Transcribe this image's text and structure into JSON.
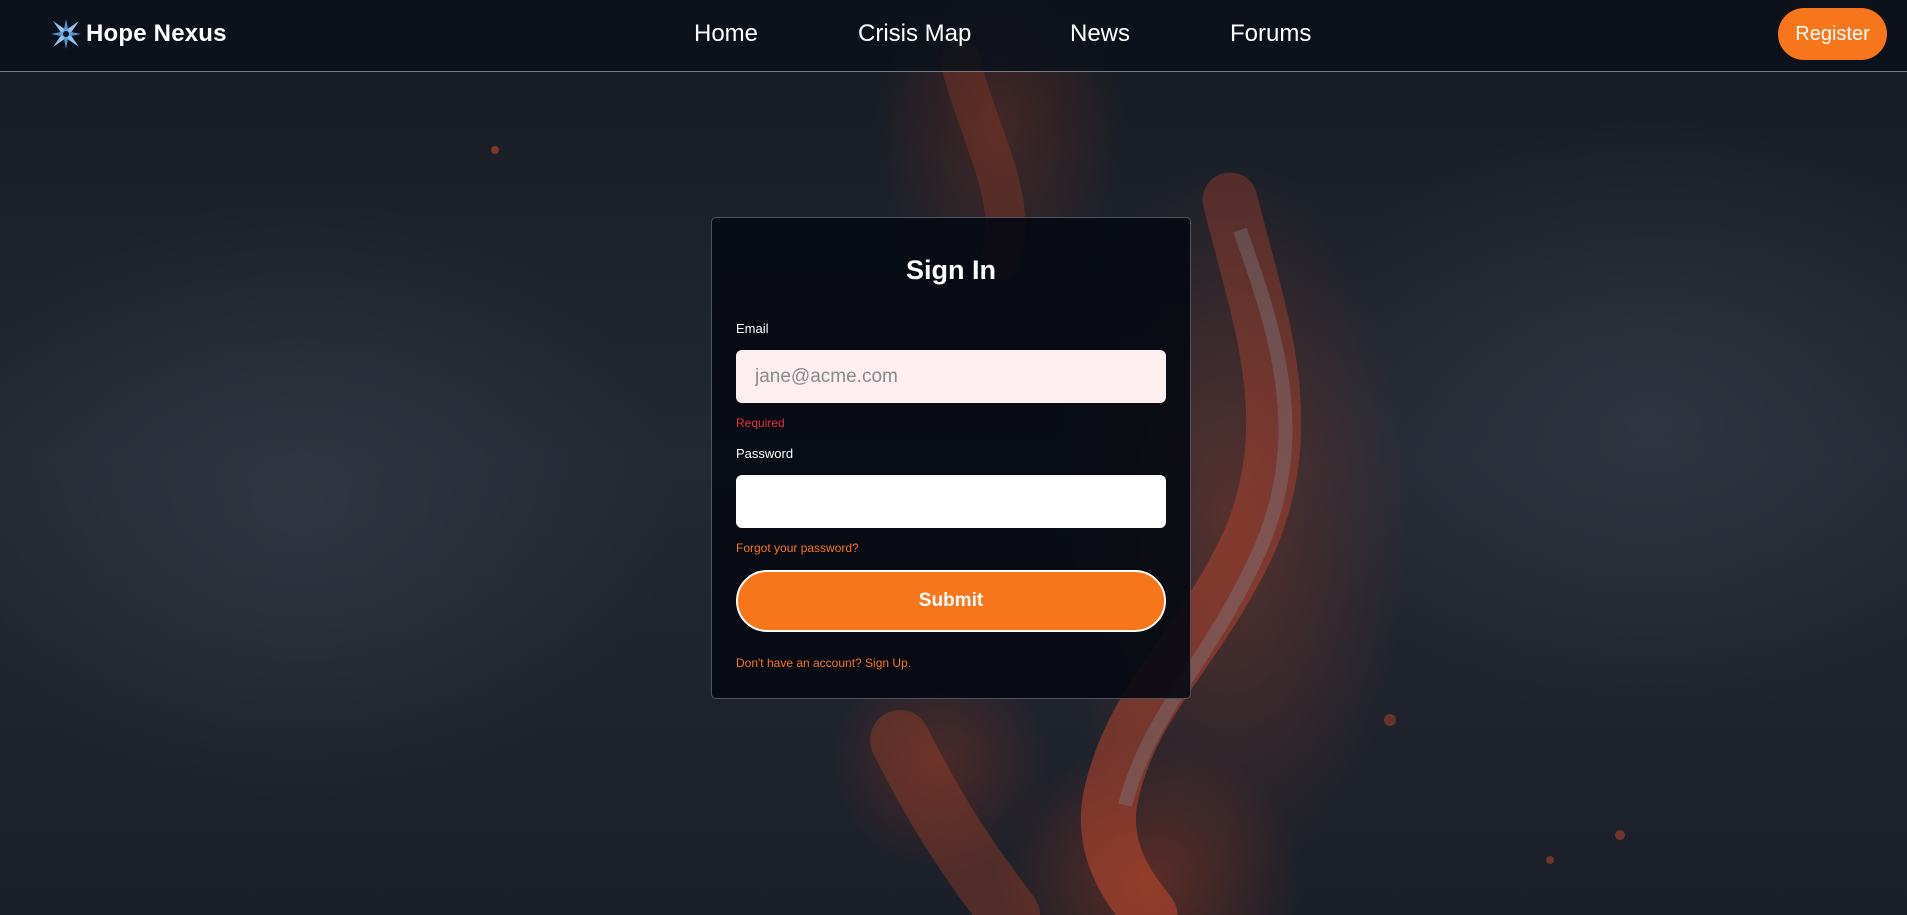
{
  "header": {
    "brand_name": "Hope Nexus",
    "brand_icon": "star-compass-icon",
    "nav": [
      {
        "label": "Home"
      },
      {
        "label": "Crisis Map"
      },
      {
        "label": "News"
      },
      {
        "label": "Forums"
      }
    ],
    "register_label": "Register"
  },
  "signin": {
    "title": "Sign In",
    "email_label": "Email",
    "email_placeholder": "jane@acme.com",
    "email_value": "",
    "email_error": "Required",
    "password_label": "Password",
    "password_value": "",
    "forgot_label": "Forgot your password?",
    "submit_label": "Submit",
    "signup_label": "Don't have an account? Sign Up."
  },
  "colors": {
    "accent": "#f7751b",
    "error": "#e0323c",
    "header_bg": "#0b101a",
    "card_bg": "#060912",
    "email_input_bg": "#fdeff0"
  }
}
